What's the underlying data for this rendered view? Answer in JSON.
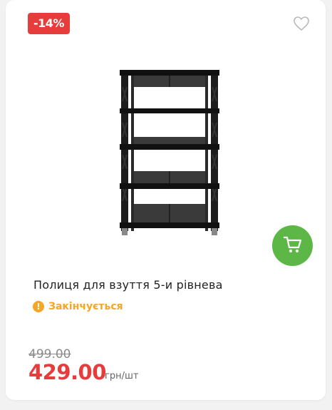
{
  "badge": {
    "discount": "-14%"
  },
  "icons": {
    "favorite": "heart-outline-icon",
    "cart": "shopping-cart-icon",
    "status": "exclamation-icon"
  },
  "product": {
    "title": "Полиця для взуття 5-и рівнева",
    "status": "Закінчується",
    "old_price": "499.00",
    "price": "429.00",
    "unit": "грн/шт"
  },
  "colors": {
    "discount": "#e73c3c",
    "cart_button": "#5cb746",
    "status": "#f5a623",
    "price": "#e73c3c"
  }
}
